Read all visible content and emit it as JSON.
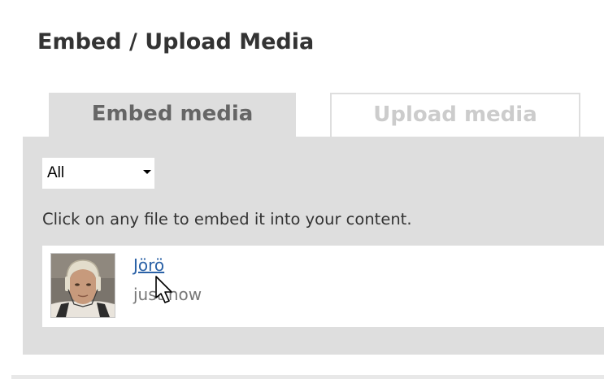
{
  "page": {
    "title": "Embed / Upload Media"
  },
  "tabs": [
    {
      "label": "Embed media",
      "active": true
    },
    {
      "label": "Upload media",
      "active": false
    }
  ],
  "filter": {
    "selected": "All"
  },
  "instructions": "Click on any file to embed it into your content.",
  "media_items": [
    {
      "name": "Jörö",
      "time": "just now",
      "thumbnail_icon": "hockey-player-photo"
    }
  ],
  "colors": {
    "panel_bg": "#dedede",
    "link": "#2a61a6",
    "active_tab_text": "#666666",
    "inactive_tab_text": "#cccccc"
  }
}
